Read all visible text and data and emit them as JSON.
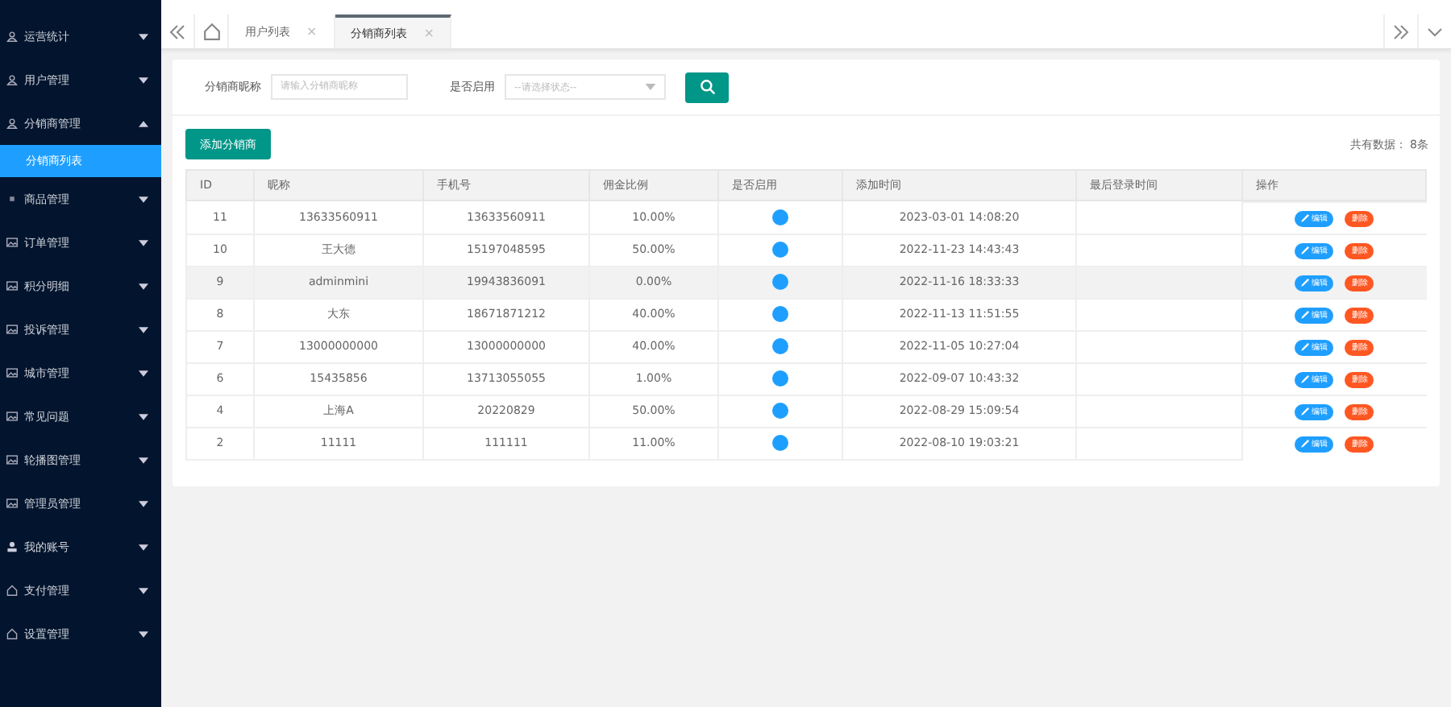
{
  "sidebar": {
    "items": [
      {
        "label": "运营统计",
        "expanded": false
      },
      {
        "label": "用户管理",
        "expanded": false
      },
      {
        "label": "分销商管理",
        "expanded": true,
        "children": [
          {
            "label": "分销商列表",
            "selected": true
          }
        ]
      },
      {
        "label": "商品管理",
        "expanded": false
      },
      {
        "label": "订单管理",
        "expanded": false
      },
      {
        "label": "积分明细",
        "expanded": false
      },
      {
        "label": "投诉管理",
        "expanded": false
      },
      {
        "label": "城市管理",
        "expanded": false
      },
      {
        "label": "常见问题",
        "expanded": false
      },
      {
        "label": "轮播图管理",
        "expanded": false
      },
      {
        "label": "管理员管理",
        "expanded": false
      },
      {
        "label": "我的账号",
        "expanded": false
      },
      {
        "label": "支付管理",
        "expanded": false
      },
      {
        "label": "设置管理",
        "expanded": false
      }
    ]
  },
  "tabs": [
    {
      "label": "用户列表",
      "close": "×",
      "selected": false
    },
    {
      "label": "分销商列表",
      "close": "×",
      "selected": true
    }
  ],
  "filters": [
    {
      "label": "分销商昵称",
      "kind": "input",
      "placeholder": "请输入分销商昵称"
    },
    {
      "label": "是否启用",
      "kind": "select",
      "placeholder": "--请选择状态--"
    }
  ],
  "add_button": "添加分销商",
  "total": "共有数据： 8条",
  "table": {
    "columns": [
      "ID",
      "昵称",
      "手机号",
      "佣金比例",
      "是否启用",
      "添加时间",
      "最后登录时间",
      "操作"
    ],
    "rows": [
      {
        "id": "11",
        "name": "13633560911",
        "phone": "13633560911",
        "ratio": "10.00%",
        "enabled": true,
        "added": "2023-03-01 14:08:20",
        "selected": false,
        "actions": [
          "编辑",
          "删除"
        ]
      },
      {
        "id": "10",
        "name": "王大德",
        "phone": "15197048595",
        "ratio": "50.00%",
        "enabled": true,
        "added": "2022-11-23 14:43:43",
        "selected": false,
        "actions": [
          "编辑",
          "删除"
        ]
      },
      {
        "id": "9",
        "name": "adminmini",
        "phone": "19943836091",
        "ratio": "0.00%",
        "enabled": true,
        "added": "2022-11-16 18:33:33",
        "selected": true,
        "actions": [
          "编辑",
          "删除"
        ]
      },
      {
        "id": "8",
        "name": "大东",
        "phone": "18671871212",
        "ratio": "40.00%",
        "enabled": true,
        "added": "2022-11-13 11:51:55",
        "selected": false,
        "actions": [
          "编辑",
          "删除"
        ]
      },
      {
        "id": "7",
        "name": "13000000000",
        "phone": "13000000000",
        "ratio": "40.00%",
        "enabled": true,
        "added": "2022-11-05 10:27:04",
        "selected": false,
        "actions": [
          "编辑",
          "删除"
        ]
      },
      {
        "id": "6",
        "name": "15435856",
        "phone": "13713055055",
        "ratio": "1.00%",
        "enabled": true,
        "added": "2022-09-07 10:43:32",
        "selected": false,
        "actions": [
          "编辑",
          "删除"
        ]
      },
      {
        "id": "4",
        "name": "上海A",
        "phone": "20220829",
        "ratio": "50.00%",
        "enabled": true,
        "added": "2022-08-29 15:09:54",
        "selected": false,
        "actions": [
          "编辑",
          "删除"
        ]
      },
      {
        "id": "2",
        "name": "11111",
        "phone": "111111",
        "ratio": "11.00%",
        "enabled": true,
        "added": "2022-08-10 19:03:21",
        "selected": false,
        "actions": [
          "编辑",
          "删除"
        ]
      }
    ]
  }
}
